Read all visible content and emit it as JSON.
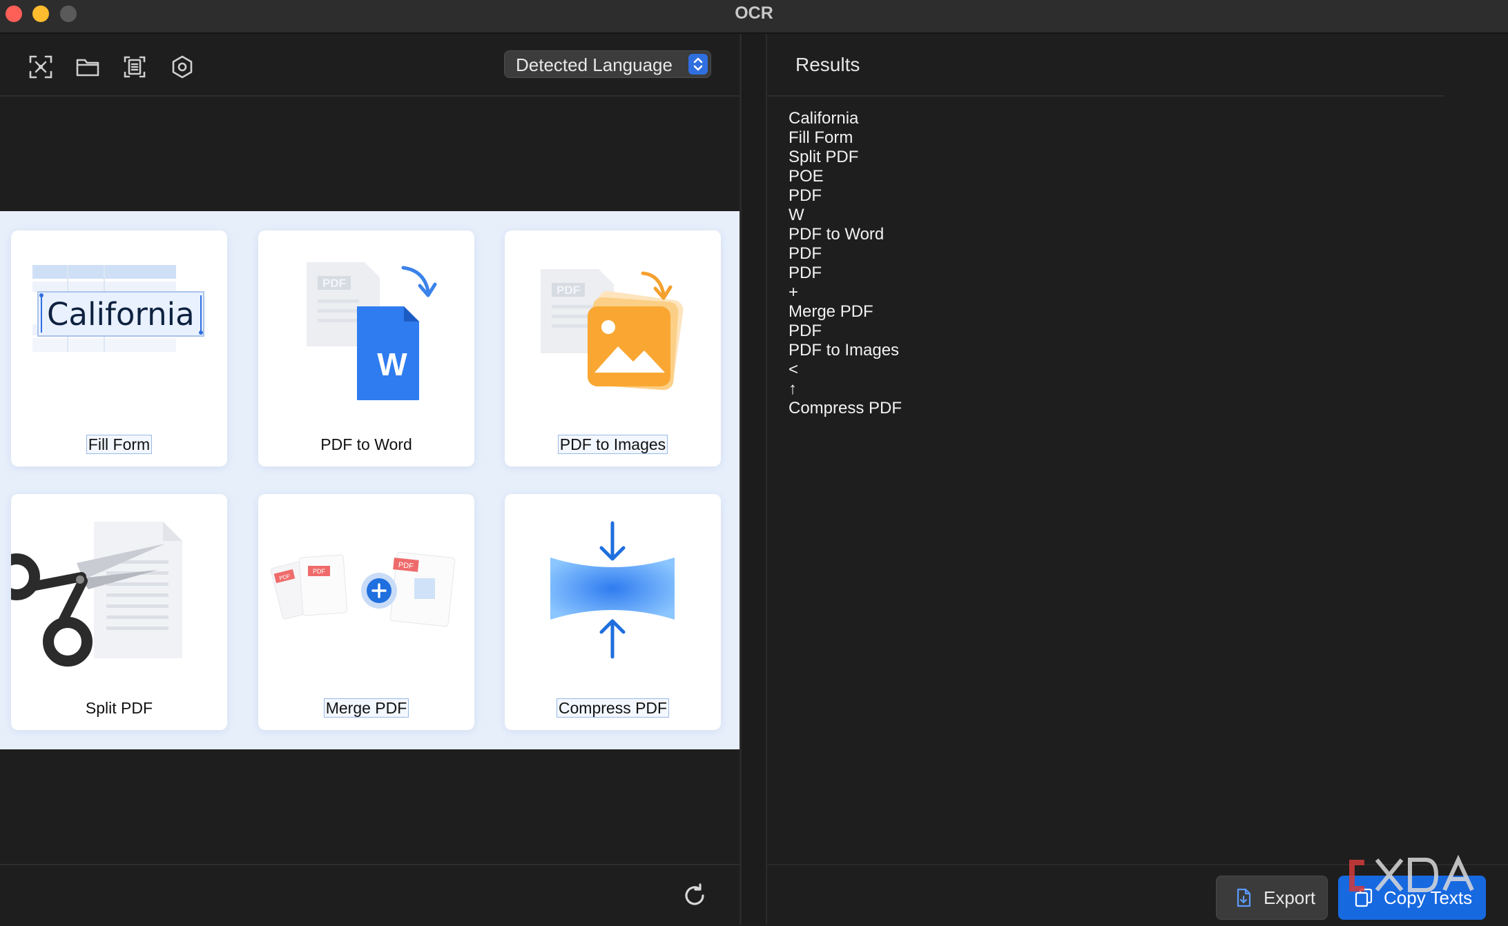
{
  "window": {
    "title": "OCR"
  },
  "toolbar": {
    "icons": [
      "capture-area-icon",
      "open-folder-icon",
      "scan-document-icon",
      "settings-icon"
    ],
    "language_select": "Detected Language"
  },
  "preview": {
    "cards": [
      {
        "label": "Fill Form",
        "art_text": "California",
        "icon": "fill-form-icon"
      },
      {
        "label": "PDF to Word",
        "art_text": "W",
        "badge": "PDF",
        "icon": "pdf-to-word-icon"
      },
      {
        "label": "PDF to Images",
        "badge": "PDF",
        "icon": "pdf-to-images-icon"
      },
      {
        "label": "Split PDF",
        "icon": "scissors-icon"
      },
      {
        "label": "Merge PDF",
        "badges": [
          "PDF",
          "PDF",
          "PDF"
        ],
        "icon": "merge-pdf-icon"
      },
      {
        "label": "Compress PDF",
        "icon": "compress-icon"
      }
    ]
  },
  "results": {
    "title": "Results",
    "lines": [
      "California",
      "Fill Form",
      "Split PDF",
      "POE",
      "PDF",
      "W",
      "PDF to Word",
      "PDF",
      "PDF",
      "+",
      "Merge PDF",
      "PDF",
      "PDF to Images",
      "<",
      "↑",
      "Compress PDF"
    ]
  },
  "footer": {
    "export_label": "Export",
    "copy_label": "Copy Texts"
  },
  "colors": {
    "accent": "#1769e0",
    "background": "#1e1e1e",
    "preview_bg": "#e7effb"
  }
}
